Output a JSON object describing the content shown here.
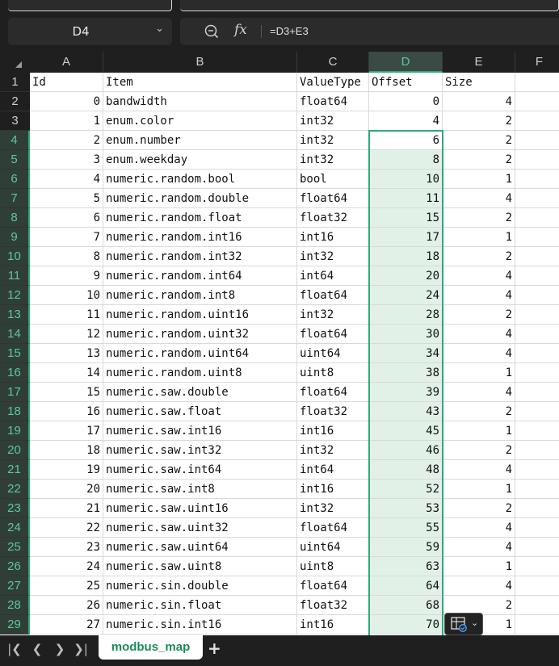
{
  "formula_bar": {
    "name_box": "D4",
    "name_box_chevron": "chevron-down-icon",
    "zoom_icon": "zoom-formula-icon",
    "fx_label": "fx",
    "formula": "=D3+E3"
  },
  "columns": [
    {
      "letter": "A",
      "selected": false
    },
    {
      "letter": "B",
      "selected": false
    },
    {
      "letter": "C",
      "selected": false
    },
    {
      "letter": "D",
      "selected": true
    },
    {
      "letter": "E",
      "selected": false
    },
    {
      "letter": "F",
      "selected": false
    }
  ],
  "rows": [
    {
      "n": "1",
      "a": "Id",
      "b": "Item",
      "c": "ValueType",
      "d": "Offset",
      "e": "Size"
    },
    {
      "n": "2",
      "a": "0",
      "b": "bandwidth",
      "c": "float64",
      "d": "0",
      "e": "4"
    },
    {
      "n": "3",
      "a": "1",
      "b": "enum.color",
      "c": "int32",
      "d": "4",
      "e": "2"
    },
    {
      "n": "4",
      "a": "2",
      "b": "enum.number",
      "c": "int32",
      "d": "6",
      "e": "2"
    },
    {
      "n": "5",
      "a": "3",
      "b": "enum.weekday",
      "c": "int32",
      "d": "8",
      "e": "2"
    },
    {
      "n": "6",
      "a": "4",
      "b": "numeric.random.bool",
      "c": "bool",
      "d": "10",
      "e": "1"
    },
    {
      "n": "7",
      "a": "5",
      "b": "numeric.random.double",
      "c": "float64",
      "d": "11",
      "e": "4"
    },
    {
      "n": "8",
      "a": "6",
      "b": "numeric.random.float",
      "c": "float32",
      "d": "15",
      "e": "2"
    },
    {
      "n": "9",
      "a": "7",
      "b": "numeric.random.int16",
      "c": "int16",
      "d": "17",
      "e": "1"
    },
    {
      "n": "10",
      "a": "8",
      "b": "numeric.random.int32",
      "c": "int32",
      "d": "18",
      "e": "2"
    },
    {
      "n": "11",
      "a": "9",
      "b": "numeric.random.int64",
      "c": "int64",
      "d": "20",
      "e": "4"
    },
    {
      "n": "12",
      "a": "10",
      "b": "numeric.random.int8",
      "c": "float64",
      "d": "24",
      "e": "4"
    },
    {
      "n": "13",
      "a": "11",
      "b": "numeric.random.uint16",
      "c": "int32",
      "d": "28",
      "e": "2"
    },
    {
      "n": "14",
      "a": "12",
      "b": "numeric.random.uint32",
      "c": "float64",
      "d": "30",
      "e": "4"
    },
    {
      "n": "15",
      "a": "13",
      "b": "numeric.random.uint64",
      "c": "uint64",
      "d": "34",
      "e": "4"
    },
    {
      "n": "16",
      "a": "14",
      "b": "numeric.random.uint8",
      "c": "uint8",
      "d": "38",
      "e": "1"
    },
    {
      "n": "17",
      "a": "15",
      "b": "numeric.saw.double",
      "c": "float64",
      "d": "39",
      "e": "4"
    },
    {
      "n": "18",
      "a": "16",
      "b": "numeric.saw.float",
      "c": "float32",
      "d": "43",
      "e": "2"
    },
    {
      "n": "19",
      "a": "17",
      "b": "numeric.saw.int16",
      "c": "int16",
      "d": "45",
      "e": "1"
    },
    {
      "n": "20",
      "a": "18",
      "b": "numeric.saw.int32",
      "c": "int32",
      "d": "46",
      "e": "2"
    },
    {
      "n": "21",
      "a": "19",
      "b": "numeric.saw.int64",
      "c": "int64",
      "d": "48",
      "e": "4"
    },
    {
      "n": "22",
      "a": "20",
      "b": "numeric.saw.int8",
      "c": "int16",
      "d": "52",
      "e": "1"
    },
    {
      "n": "23",
      "a": "21",
      "b": "numeric.saw.uint16",
      "c": "int32",
      "d": "53",
      "e": "2"
    },
    {
      "n": "24",
      "a": "22",
      "b": "numeric.saw.uint32",
      "c": "float64",
      "d": "55",
      "e": "4"
    },
    {
      "n": "25",
      "a": "23",
      "b": "numeric.saw.uint64",
      "c": "uint64",
      "d": "59",
      "e": "4"
    },
    {
      "n": "26",
      "a": "24",
      "b": "numeric.saw.uint8",
      "c": "uint8",
      "d": "63",
      "e": "1"
    },
    {
      "n": "27",
      "a": "25",
      "b": "numeric.sin.double",
      "c": "float64",
      "d": "64",
      "e": "4"
    },
    {
      "n": "28",
      "a": "26",
      "b": "numeric.sin.float",
      "c": "float32",
      "d": "68",
      "e": "2"
    },
    {
      "n": "29",
      "a": "27",
      "b": "numeric.sin.int16",
      "c": "int16",
      "d": "70",
      "e": "1"
    }
  ],
  "selection": {
    "active_cell": "D4",
    "range": "D4:D29"
  },
  "quick_analysis_icon": "quick-analysis-icon",
  "sheet_tabs": {
    "nav_icons": [
      "first-sheet-icon",
      "prev-sheet-icon",
      "next-sheet-icon",
      "last-sheet-icon"
    ],
    "active_sheet": "modbus_map",
    "add_icon": "plus-icon"
  },
  "colors": {
    "accent": "#2fa878",
    "selection_fill": "#e2f1e8",
    "chrome": "#1f1f1f"
  }
}
